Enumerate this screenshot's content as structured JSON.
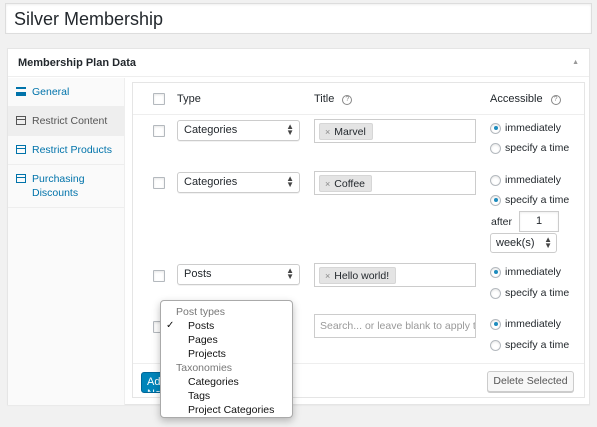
{
  "post_title": "Silver Membership",
  "metabox": {
    "title": "Membership Plan Data",
    "toggle_icon": "triangle-up-icon"
  },
  "sidebar": {
    "items": [
      {
        "label": "General",
        "icon": "list-icon",
        "active": false
      },
      {
        "label": "Restrict Content",
        "icon": "box-icon",
        "active": true
      },
      {
        "label": "Restrict Products",
        "icon": "box-icon",
        "active": false
      },
      {
        "label": "Purchasing Discounts",
        "icon": "box-icon",
        "active": false
      }
    ]
  },
  "table": {
    "headers": {
      "type": "Type",
      "title": "Title",
      "accessible": "Accessible"
    },
    "rows": [
      {
        "type": "Categories",
        "title_tag": "Marvel",
        "access": "immediately"
      },
      {
        "type": "Categories",
        "title_tag": "Coffee",
        "access": "specify a time",
        "after_label": "after",
        "after_value": "1",
        "period": "week(s)"
      },
      {
        "type": "Posts",
        "title_tag": "Hello world!",
        "access": "immediately"
      },
      {
        "type": "Posts",
        "title_placeholder": "Search... or leave blank to apply to all",
        "access": "immediately"
      }
    ],
    "radio_labels": {
      "immediately": "immediately",
      "specify": "specify a time"
    },
    "tag_remove": "×"
  },
  "footer": {
    "add_label": "Add New Rule",
    "delete_label": "Delete Selected"
  },
  "dropdown": {
    "groups": [
      {
        "label": "Post types",
        "options": [
          {
            "label": "Posts",
            "checked": true
          },
          {
            "label": "Pages"
          },
          {
            "label": "Projects"
          }
        ]
      },
      {
        "label": "Taxonomies",
        "options": [
          {
            "label": "Categories"
          },
          {
            "label": "Tags"
          },
          {
            "label": "Project Categories"
          }
        ]
      }
    ],
    "check_glyph": "✓"
  },
  "colors": {
    "primary_button": "#0085ba",
    "link": "#0073aa",
    "radio_checked": "#1e8cbe"
  }
}
